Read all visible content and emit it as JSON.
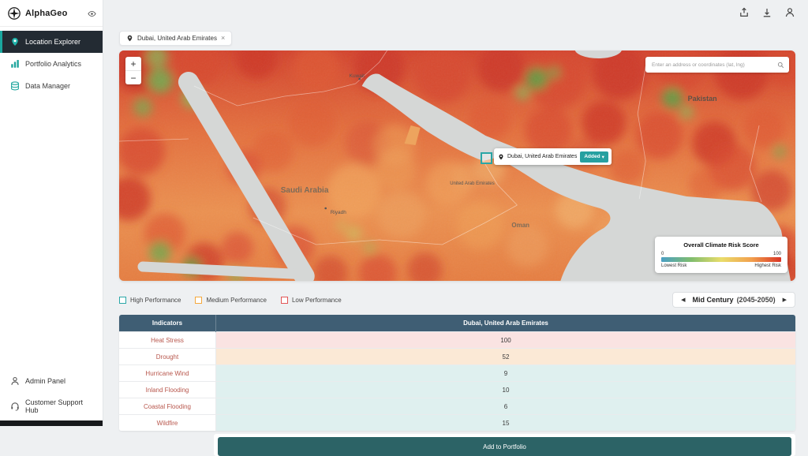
{
  "brand": {
    "name": "AlphaGeo"
  },
  "sidebar": {
    "items": [
      {
        "label": "Location Explorer",
        "icon": "location-pin-icon",
        "active": true
      },
      {
        "label": "Portfolio Analytics",
        "icon": "bar-chart-icon",
        "active": false
      },
      {
        "label": "Data Manager",
        "icon": "database-icon",
        "active": false
      }
    ],
    "footer_items": [
      {
        "label": "Admin Panel",
        "icon": "person-icon"
      },
      {
        "label": "Customer Support Hub",
        "icon": "headset-icon"
      }
    ]
  },
  "header": {
    "icons": [
      "export-icon",
      "download-icon",
      "account-icon"
    ]
  },
  "location_chip": {
    "label": "Dubai, United Arab Emirates",
    "close": "×"
  },
  "map": {
    "zoom_in": "+",
    "zoom_out": "−",
    "search_placeholder": "Enter an address or coordinates (lat, lng)",
    "country_labels": [
      "Kuwait",
      "Saudi Arabia",
      "Riyadh",
      "Pakistan",
      "Oman",
      "United Arab Emirates"
    ],
    "marker": {
      "tooltip": "Dubai, United Arab Emirates",
      "status": "Added",
      "chevron": "▾"
    },
    "legend": {
      "title": "Overall Climate Risk Score",
      "min": "0",
      "max": "100",
      "min_label": "Lowest Risk",
      "max_label": "Highest Risk"
    }
  },
  "performance_legend": [
    {
      "label": "High Performance",
      "color": "#2aa7a7"
    },
    {
      "label": "Medium Performance",
      "color": "#f5a83c"
    },
    {
      "label": "Low Performance",
      "color": "#e25555"
    }
  ],
  "time_selector": {
    "prev": "◀",
    "period": "Mid Century",
    "range": "(2045-2050)",
    "next": "▶"
  },
  "table": {
    "columns": [
      "Indicators",
      "Dubai, United Arab Emirates"
    ],
    "rows": [
      {
        "indicator": "Heat Stress",
        "value": "100",
        "performance": "low"
      },
      {
        "indicator": "Drought",
        "value": "52",
        "performance": "medium"
      },
      {
        "indicator": "Hurricane Wind",
        "value": "9",
        "performance": "high"
      },
      {
        "indicator": "Inland Flooding",
        "value": "10",
        "performance": "high"
      },
      {
        "indicator": "Coastal Flooding",
        "value": "6",
        "performance": "high"
      },
      {
        "indicator": "Wildfire",
        "value": "15",
        "performance": "high"
      }
    ]
  },
  "footer": {
    "add_to_portfolio": "Add to Portfolio"
  },
  "colors": {
    "accent": "#1aa79f",
    "active_nav_bg": "#232b33",
    "table_header": "#3f5e74",
    "performance_low_bg": "#fae3e2",
    "performance_medium_bg": "#fbe9d6",
    "performance_high_bg": "#dff0ef",
    "risk_gradient": [
      "#4a9fc4",
      "#80bd6e",
      "#e9dd6b",
      "#f2a14e",
      "#d93425"
    ]
  }
}
